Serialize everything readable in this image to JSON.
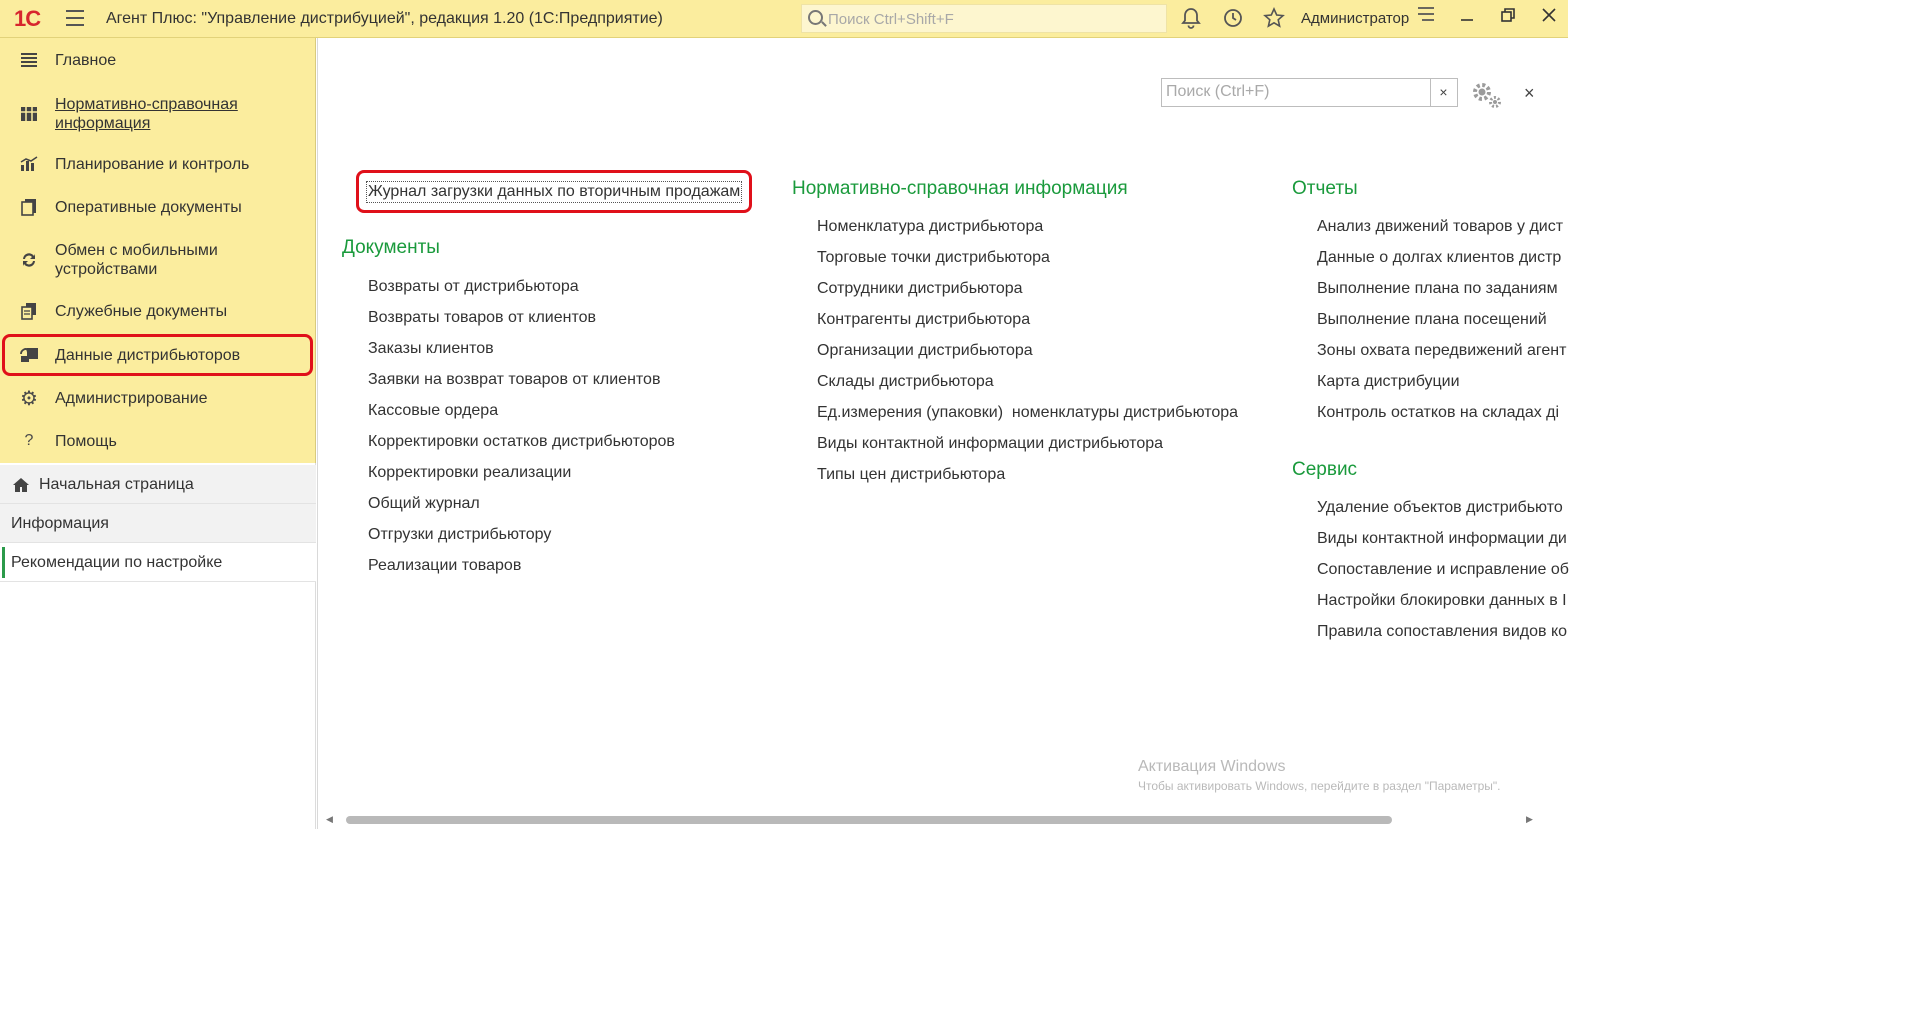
{
  "titlebar": {
    "logo": "1С",
    "title": "Агент Плюс: \"Управление дистрибуцией\", редакция 1.20  (1С:Предприятие)",
    "search_placeholder": "Поиск Ctrl+Shift+F",
    "user": "Администратор"
  },
  "sidebar": {
    "items": [
      {
        "label": "Главное",
        "icon": "list-icon"
      },
      {
        "label": "Нормативно-справочная информация",
        "icon": "grid-icon"
      },
      {
        "label": "Планирование и контроль",
        "icon": "bar-chart-icon"
      },
      {
        "label": "Оперативные документы",
        "icon": "documents-icon"
      },
      {
        "label": "Обмен с мобильными устройствами",
        "icon": "sync-icon"
      },
      {
        "label": "Служебные документы",
        "icon": "docs-icon"
      },
      {
        "label": "Данные дистрибьюторов",
        "icon": "distributor-icon"
      },
      {
        "label": "Администрирование",
        "icon": "gear-icon"
      },
      {
        "label": "Помощь",
        "icon": "help-icon"
      }
    ],
    "nav": [
      {
        "label": "Начальная страница"
      },
      {
        "label": "Информация"
      },
      {
        "label": "Рекомендации по настройке"
      }
    ]
  },
  "main": {
    "search_placeholder": "Поиск (Ctrl+F)",
    "clear": "×",
    "close": "×",
    "highlight_link": "Журнал загрузки данных по вторичным продажам",
    "sections": {
      "documents": {
        "title": "Документы",
        "links": [
          "Возвраты от дистрибьютора",
          "Возвраты товаров от клиентов",
          "Заказы клиентов",
          "Заявки на возврат товаров от клиентов",
          "Кассовые ордера",
          "Корректировки остатков дистрибьюторов",
          "Корректировки реализации",
          "Общий журнал",
          "Отгрузки дистрибьютору",
          "Реализации товаров"
        ]
      },
      "nsi": {
        "title": "Нормативно-справочная информация",
        "links": [
          "Номенклатура дистрибьютора",
          "Торговые точки дистрибьютора",
          "Сотрудники дистрибьютора",
          "Контрагенты дистрибьютора",
          "Организации дистрибьютора",
          "Склады дистрибьютора",
          "Ед.измерения (упаковки)  номенклатуры дистрибьютора",
          "Виды контактной информации дистрибьютора",
          "Типы цен дистрибьютора"
        ]
      },
      "reports": {
        "title": "Отчеты",
        "links": [
          "Анализ движений товаров у дист",
          "Данные о долгах клиентов дистр",
          "Выполнение плана по заданиям",
          "Выполнение плана посещений",
          "Зоны охвата передвижений агент",
          "Карта дистрибуции",
          "Контроль остатков на складах ді"
        ]
      },
      "service": {
        "title": "Сервис",
        "links": [
          "Удаление объектов дистрибьюто",
          "Виды контактной информации ди",
          "Сопоставление и исправление об",
          "Настройки блокировки данных в I",
          "Правила сопоставления видов ко"
        ]
      }
    },
    "watermark": {
      "line1": "Активация Windows",
      "line2": "Чтобы активировать Windows, перейдите в раздел \"Параметры\"."
    }
  },
  "colors": {
    "sidebar_bg": "#fbed9e",
    "section_title": "#1a9a3c",
    "highlight": "#e0101a"
  }
}
